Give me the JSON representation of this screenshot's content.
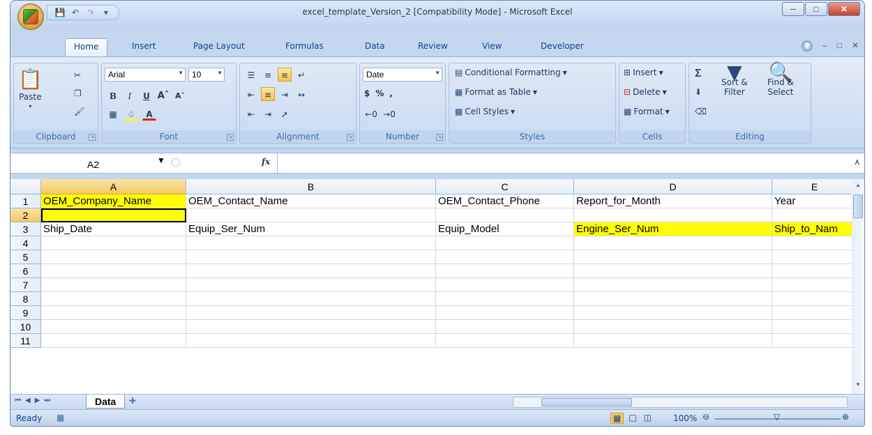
{
  "window": {
    "title": "excel_template_Version_2  [Compatibility Mode] - Microsoft Excel"
  },
  "tabs": [
    "Home",
    "Insert",
    "Page Layout",
    "Formulas",
    "Data",
    "Review",
    "View",
    "Developer"
  ],
  "ribbon": {
    "clipboard": {
      "label": "Clipboard",
      "paste": "Paste"
    },
    "font": {
      "label": "Font",
      "name": "Arial",
      "size": "10"
    },
    "alignment": {
      "label": "Alignment"
    },
    "number": {
      "label": "Number",
      "format": "Date",
      "currency": "$",
      "percent": "%",
      "comma": ","
    },
    "styles": {
      "label": "Styles",
      "conditional": "Conditional Formatting",
      "table": "Format as Table",
      "cell_styles": "Cell Styles"
    },
    "cells": {
      "label": "Cells",
      "insert": "Insert",
      "delete": "Delete",
      "format": "Format"
    },
    "editing": {
      "label": "Editing",
      "sort1": "Sort &",
      "sort2": "Filter",
      "find1": "Find &",
      "find2": "Select"
    }
  },
  "formula_bar": {
    "name_box": "A2",
    "fx": "fx",
    "value": ""
  },
  "columns": [
    "A",
    "B",
    "C",
    "D",
    "E"
  ],
  "rows": [
    "1",
    "2",
    "3",
    "4",
    "5",
    "6",
    "7",
    "8",
    "9",
    "10",
    "11"
  ],
  "cells": {
    "A1": "OEM_Company_Name",
    "B1": "OEM_Contact_Name",
    "C1": "OEM_Contact_Phone",
    "D1": "Report_for_Month",
    "E1": "Year",
    "A3": "Ship_Date",
    "B3": "Equip_Ser_Num",
    "C3": "Equip_Model",
    "D3": "Engine_Ser_Num",
    "E3": "Ship_to_Nam"
  },
  "sheet_tabs": [
    "Data"
  ],
  "status": {
    "text": "Ready",
    "zoom": "100%"
  }
}
